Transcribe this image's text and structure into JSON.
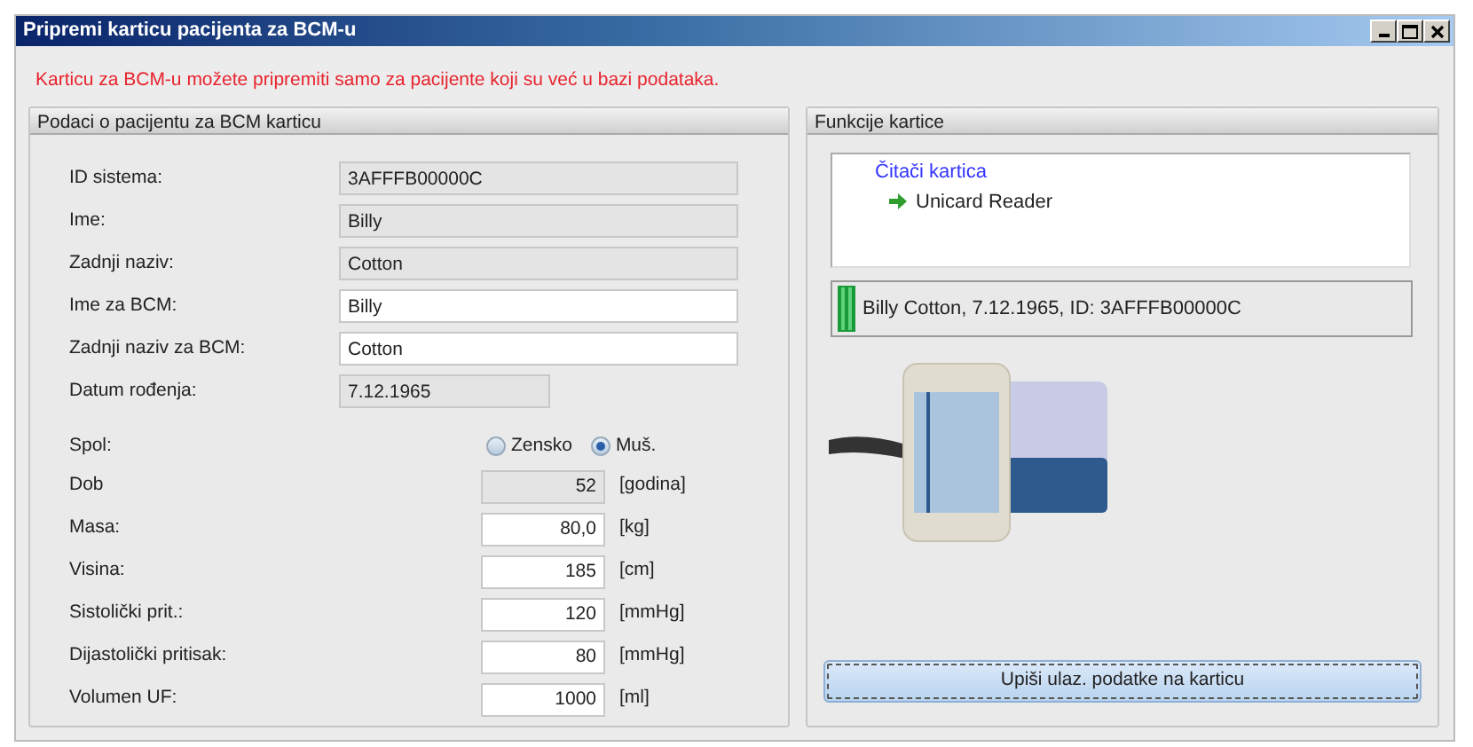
{
  "window": {
    "title": "Pripremi karticu pacijenta za BCM-u"
  },
  "notice": "Karticu za BCM-u možete pripremiti samo za pacijente koji su već u bazi podataka.",
  "patient_panel": {
    "title": "Podaci o pacijentu za BCM karticu",
    "fields": [
      {
        "label": "ID sistema:",
        "value": "3AFFFB00000C",
        "kind": "text",
        "editable": false
      },
      {
        "label": "Ime:",
        "value": "Billy",
        "kind": "text",
        "editable": false
      },
      {
        "label": "Zadnji naziv:",
        "value": "Cotton",
        "kind": "text",
        "editable": false
      },
      {
        "label": "Ime za BCM:",
        "value": "Billy",
        "kind": "text",
        "editable": true
      },
      {
        "label": "Zadnji naziv za BCM:",
        "value": "Cotton",
        "kind": "text",
        "editable": true
      },
      {
        "label": "Datum rođenja:",
        "value": "7.12.1965",
        "kind": "date",
        "editable": false
      }
    ],
    "gender": {
      "label": "Spol:",
      "options": [
        {
          "label": "Zensko",
          "selected": false
        },
        {
          "label": "Muš.",
          "selected": true
        }
      ]
    },
    "measures": [
      {
        "label": "Dob",
        "value": "52",
        "unit": "[godina]",
        "editable": false
      },
      {
        "label": "Masa:",
        "value": "80,0",
        "unit": "[kg]",
        "editable": true
      },
      {
        "label": "Visina:",
        "value": "185",
        "unit": "[cm]",
        "editable": true
      },
      {
        "label": "Sistolički prit.:",
        "value": "120",
        "unit": "[mmHg]",
        "editable": true
      },
      {
        "label": "Dijastolički pritisak:",
        "value": "80",
        "unit": "[mmHg]",
        "editable": true
      },
      {
        "label": "Volumen UF:",
        "value": "1000",
        "unit": "[ml]",
        "editable": true
      }
    ]
  },
  "card_panel": {
    "title": "Funkcije kartice",
    "tree": [
      {
        "label": "Čitači kartica",
        "children": [
          {
            "label": "Unicard Reader"
          }
        ]
      }
    ],
    "card_status": "Billy Cotton, 7.12.1965, ID: 3AFFFB00000C",
    "button": "Upiši ulaz. podatke na karticu"
  }
}
